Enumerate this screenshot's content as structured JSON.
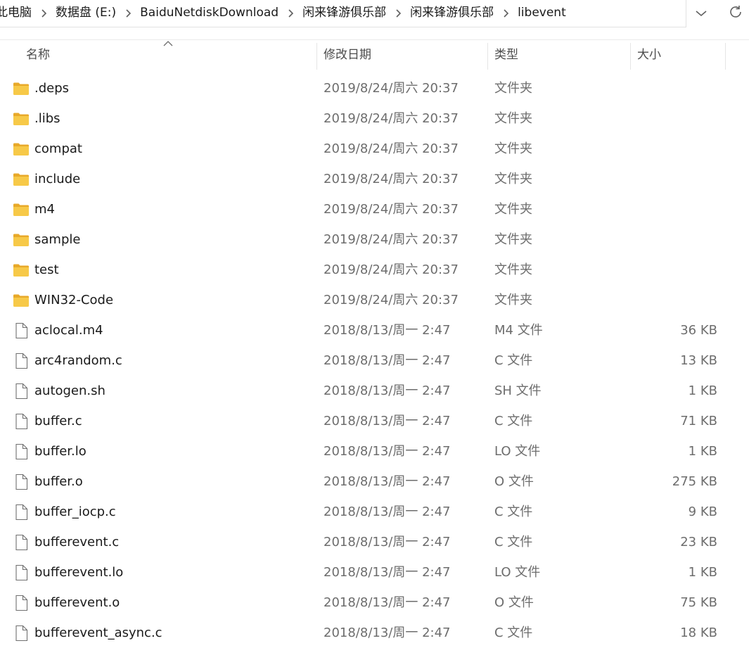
{
  "breadcrumb": {
    "items": [
      {
        "label": "此电脑"
      },
      {
        "label": "数据盘 (E:)"
      },
      {
        "label": "BaiduNetdiskDownload"
      },
      {
        "label": "闲来锋游俱乐部"
      },
      {
        "label": "闲来锋游俱乐部"
      },
      {
        "label": "libevent"
      }
    ],
    "separator_icon": "chevron-right-icon",
    "dropdown_icon": "chevron-down-icon",
    "refresh_icon": "refresh-icon"
  },
  "columns": {
    "name": "名称",
    "date": "修改日期",
    "type": "类型",
    "size": "大小",
    "sort_icon": "sort-up-icon"
  },
  "files": [
    {
      "name": ".deps",
      "date": "2019/8/24/周六 20:37",
      "type": "文件夹",
      "size": "",
      "icon": "folder-icon"
    },
    {
      "name": ".libs",
      "date": "2019/8/24/周六 20:37",
      "type": "文件夹",
      "size": "",
      "icon": "folder-icon"
    },
    {
      "name": "compat",
      "date": "2019/8/24/周六 20:37",
      "type": "文件夹",
      "size": "",
      "icon": "folder-icon"
    },
    {
      "name": "include",
      "date": "2019/8/24/周六 20:37",
      "type": "文件夹",
      "size": "",
      "icon": "folder-icon"
    },
    {
      "name": "m4",
      "date": "2019/8/24/周六 20:37",
      "type": "文件夹",
      "size": "",
      "icon": "folder-icon"
    },
    {
      "name": "sample",
      "date": "2019/8/24/周六 20:37",
      "type": "文件夹",
      "size": "",
      "icon": "folder-icon"
    },
    {
      "name": "test",
      "date": "2019/8/24/周六 20:37",
      "type": "文件夹",
      "size": "",
      "icon": "folder-icon"
    },
    {
      "name": "WIN32-Code",
      "date": "2019/8/24/周六 20:37",
      "type": "文件夹",
      "size": "",
      "icon": "folder-icon"
    },
    {
      "name": "aclocal.m4",
      "date": "2018/8/13/周一 2:47",
      "type": "M4 文件",
      "size": "36 KB",
      "icon": "file-icon"
    },
    {
      "name": "arc4random.c",
      "date": "2018/8/13/周一 2:47",
      "type": "C 文件",
      "size": "13 KB",
      "icon": "file-icon"
    },
    {
      "name": "autogen.sh",
      "date": "2018/8/13/周一 2:47",
      "type": "SH 文件",
      "size": "1 KB",
      "icon": "file-icon"
    },
    {
      "name": "buffer.c",
      "date": "2018/8/13/周一 2:47",
      "type": "C 文件",
      "size": "71 KB",
      "icon": "file-icon"
    },
    {
      "name": "buffer.lo",
      "date": "2018/8/13/周一 2:47",
      "type": "LO 文件",
      "size": "1 KB",
      "icon": "file-icon"
    },
    {
      "name": "buffer.o",
      "date": "2018/8/13/周一 2:47",
      "type": "O 文件",
      "size": "275 KB",
      "icon": "file-icon"
    },
    {
      "name": "buffer_iocp.c",
      "date": "2018/8/13/周一 2:47",
      "type": "C 文件",
      "size": "9 KB",
      "icon": "file-icon"
    },
    {
      "name": "bufferevent.c",
      "date": "2018/8/13/周一 2:47",
      "type": "C 文件",
      "size": "23 KB",
      "icon": "file-icon"
    },
    {
      "name": "bufferevent.lo",
      "date": "2018/8/13/周一 2:47",
      "type": "LO 文件",
      "size": "1 KB",
      "icon": "file-icon"
    },
    {
      "name": "bufferevent.o",
      "date": "2018/8/13/周一 2:47",
      "type": "O 文件",
      "size": "75 KB",
      "icon": "file-icon"
    },
    {
      "name": "bufferevent_async.c",
      "date": "2018/8/13/周一 2:47",
      "type": "C 文件",
      "size": "18 KB",
      "icon": "file-icon"
    }
  ],
  "colors": {
    "folder_yellow": "#f7c948",
    "folder_dark": "#e8a92a",
    "text_primary": "#1a1a1a",
    "text_secondary": "#6d6d6d",
    "icon_gray": "#5f5f5f"
  }
}
